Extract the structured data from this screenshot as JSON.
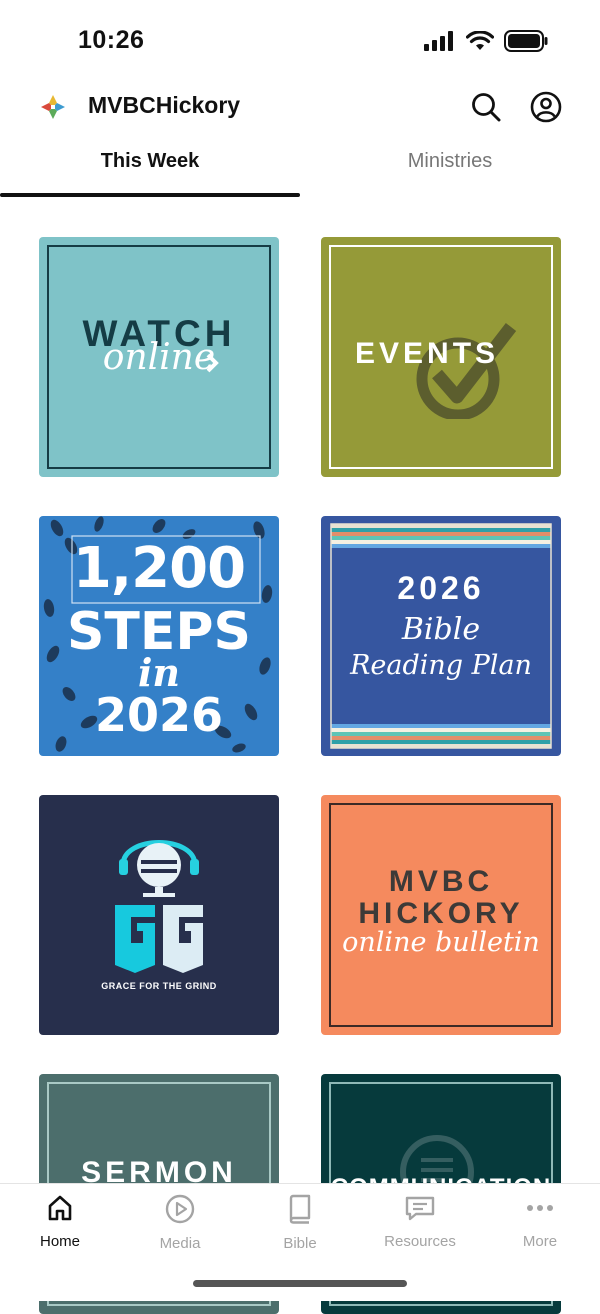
{
  "status_bar": {
    "time": "10:26"
  },
  "header": {
    "app_title": "MVBCHickory"
  },
  "tabs": [
    {
      "label": "This Week",
      "active": true
    },
    {
      "label": "Ministries",
      "active": false
    }
  ],
  "tiles": {
    "watch": {
      "line1": "WATCH",
      "line2": "online",
      "color": "#7fc3c8"
    },
    "events": {
      "line1": "EVENTS",
      "color": "#959a38"
    },
    "steps": {
      "line1": "1,200",
      "line2": "STEPS",
      "line3": "in",
      "line4": "2026",
      "color": "#3480c8"
    },
    "reading": {
      "line1": "2026",
      "line2": "Bible",
      "line3": "Reading Plan",
      "color": "#3656a0"
    },
    "grind": {
      "caption": "GRACE FOR THE GRIND",
      "color": "#272f4c"
    },
    "bulletin": {
      "line1": "MVBC",
      "line2": "HICKORY",
      "line3": "online bulletin",
      "color": "#f58a5e"
    },
    "sermon": {
      "line1": "SERMON",
      "color": "#4c6e6c"
    },
    "communication": {
      "line1": "COMMUNICATION",
      "color": "#063a3c"
    }
  },
  "bottom_nav": [
    {
      "label": "Home",
      "icon": "home-icon",
      "active": true
    },
    {
      "label": "Media",
      "icon": "play-icon",
      "active": false
    },
    {
      "label": "Bible",
      "icon": "book-icon",
      "active": false
    },
    {
      "label": "Resources",
      "icon": "message-icon",
      "active": false
    },
    {
      "label": "More",
      "icon": "more-icon",
      "active": false
    }
  ]
}
